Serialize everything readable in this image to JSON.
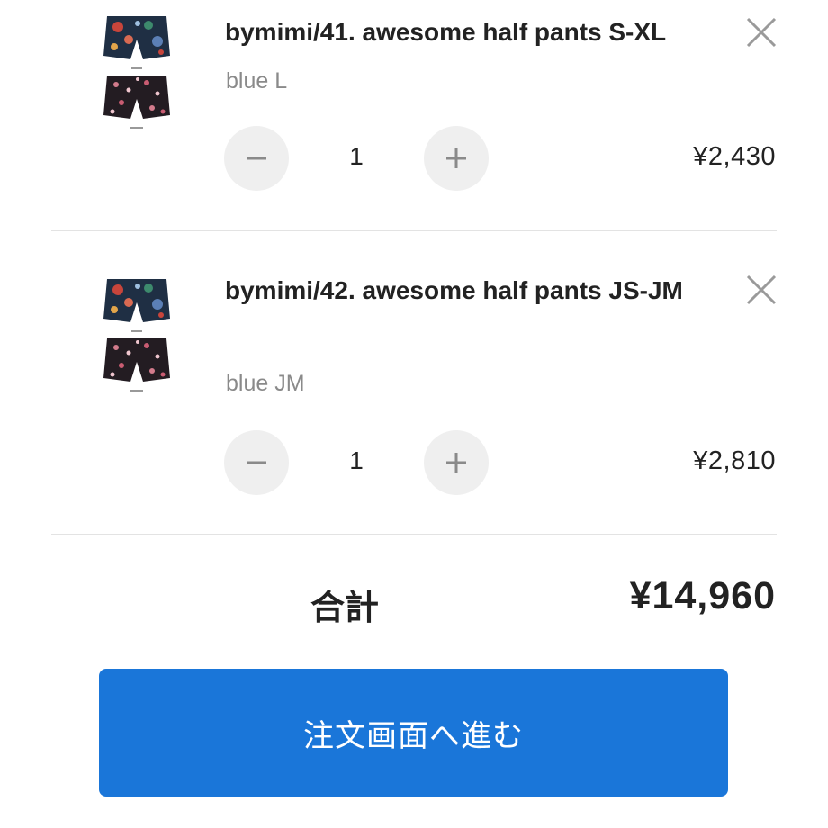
{
  "cart": {
    "items": [
      {
        "title": "bymimi/41. awesome half pants S-XL",
        "variant": "blue L",
        "quantity": "1",
        "price": "¥2,430",
        "thumb_labels": [
          "blue",
          "black"
        ]
      },
      {
        "title": "bymimi/42. awesome half pants JS-JM",
        "variant": "blue JM",
        "quantity": "1",
        "price": "¥2,810",
        "thumb_labels": [
          "blue",
          "black"
        ]
      }
    ],
    "controls": {
      "minus_icon": "minus-icon",
      "plus_icon": "plus-icon",
      "remove_icon": "close-icon"
    }
  },
  "summary": {
    "total_label": "合計",
    "total_value": "¥14,960"
  },
  "checkout": {
    "label": "注文画面へ進む"
  },
  "colors": {
    "accent": "#1a76d9",
    "text": "#222222",
    "muted": "#8a8a8a",
    "button_bg": "#efefef",
    "divider": "#e3e3e3"
  }
}
